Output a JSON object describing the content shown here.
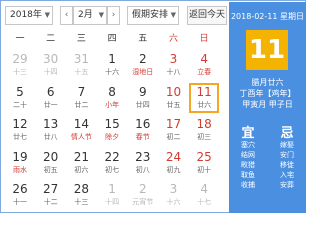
{
  "toolbar": {
    "year": "2018年",
    "prev": "‹",
    "month": "2月",
    "next": "›",
    "holiday": "假期安排",
    "today_btn": "返回今天"
  },
  "weekdays": [
    "一",
    "二",
    "三",
    "四",
    "五",
    "六",
    "日"
  ],
  "rows": [
    [
      {
        "d": "29",
        "l": "十三",
        "other": true
      },
      {
        "d": "30",
        "l": "十四",
        "other": true
      },
      {
        "d": "31",
        "l": "十五",
        "other": true
      },
      {
        "d": "1",
        "l": "十六"
      },
      {
        "d": "2",
        "l": "湿地日",
        "fest": true
      },
      {
        "d": "3",
        "l": "十八",
        "we": true
      },
      {
        "d": "4",
        "l": "立春",
        "we": true,
        "fest": true
      }
    ],
    [
      {
        "d": "5",
        "l": "二十"
      },
      {
        "d": "6",
        "l": "廿一"
      },
      {
        "d": "7",
        "l": "廿二"
      },
      {
        "d": "8",
        "l": "小年",
        "fest": true
      },
      {
        "d": "9",
        "l": "廿四"
      },
      {
        "d": "10",
        "l": "廿五",
        "we": true
      },
      {
        "d": "11",
        "l": "廿六",
        "we": true,
        "today": true
      }
    ],
    [
      {
        "d": "12",
        "l": "廿七"
      },
      {
        "d": "13",
        "l": "廿八"
      },
      {
        "d": "14",
        "l": "情人节",
        "fest": true
      },
      {
        "d": "15",
        "l": "除夕",
        "fest": true
      },
      {
        "d": "16",
        "l": "春节",
        "fest": true
      },
      {
        "d": "17",
        "l": "初二",
        "we": true
      },
      {
        "d": "18",
        "l": "初三",
        "we": true
      }
    ],
    [
      {
        "d": "19",
        "l": "雨水",
        "fest": true
      },
      {
        "d": "20",
        "l": "初五"
      },
      {
        "d": "21",
        "l": "初六"
      },
      {
        "d": "22",
        "l": "初七"
      },
      {
        "d": "23",
        "l": "初八"
      },
      {
        "d": "24",
        "l": "初九",
        "we": true
      },
      {
        "d": "25",
        "l": "初十",
        "we": true
      }
    ],
    [
      {
        "d": "26",
        "l": "十一"
      },
      {
        "d": "27",
        "l": "十二"
      },
      {
        "d": "28",
        "l": "十三"
      },
      {
        "d": "1",
        "l": "十四",
        "other": true
      },
      {
        "d": "2",
        "l": "元宵节",
        "other": true
      },
      {
        "d": "3",
        "l": "十六",
        "other": true
      },
      {
        "d": "4",
        "l": "十七",
        "other": true
      }
    ]
  ],
  "panel": {
    "date_line": "2018-02-11 星期日",
    "big_day": "11",
    "lunar_line1": "腊月廿六",
    "lunar_line2": "丁酉年【鸡年】",
    "lunar_line3": "甲寅月 甲子日",
    "yi_label": "宜",
    "ji_label": "忌",
    "yi_items": [
      "塞穴",
      "结网",
      "畋猎",
      "取鱼",
      "收捕"
    ],
    "ji_items": [
      "嫁娶",
      "安门",
      "移徙",
      "入宅",
      "安葬"
    ]
  },
  "colors": {
    "accent": "#4a8fe0",
    "today_bg": "#f5b301",
    "weekend": "#d43c33",
    "today_border": "#f5a623"
  }
}
